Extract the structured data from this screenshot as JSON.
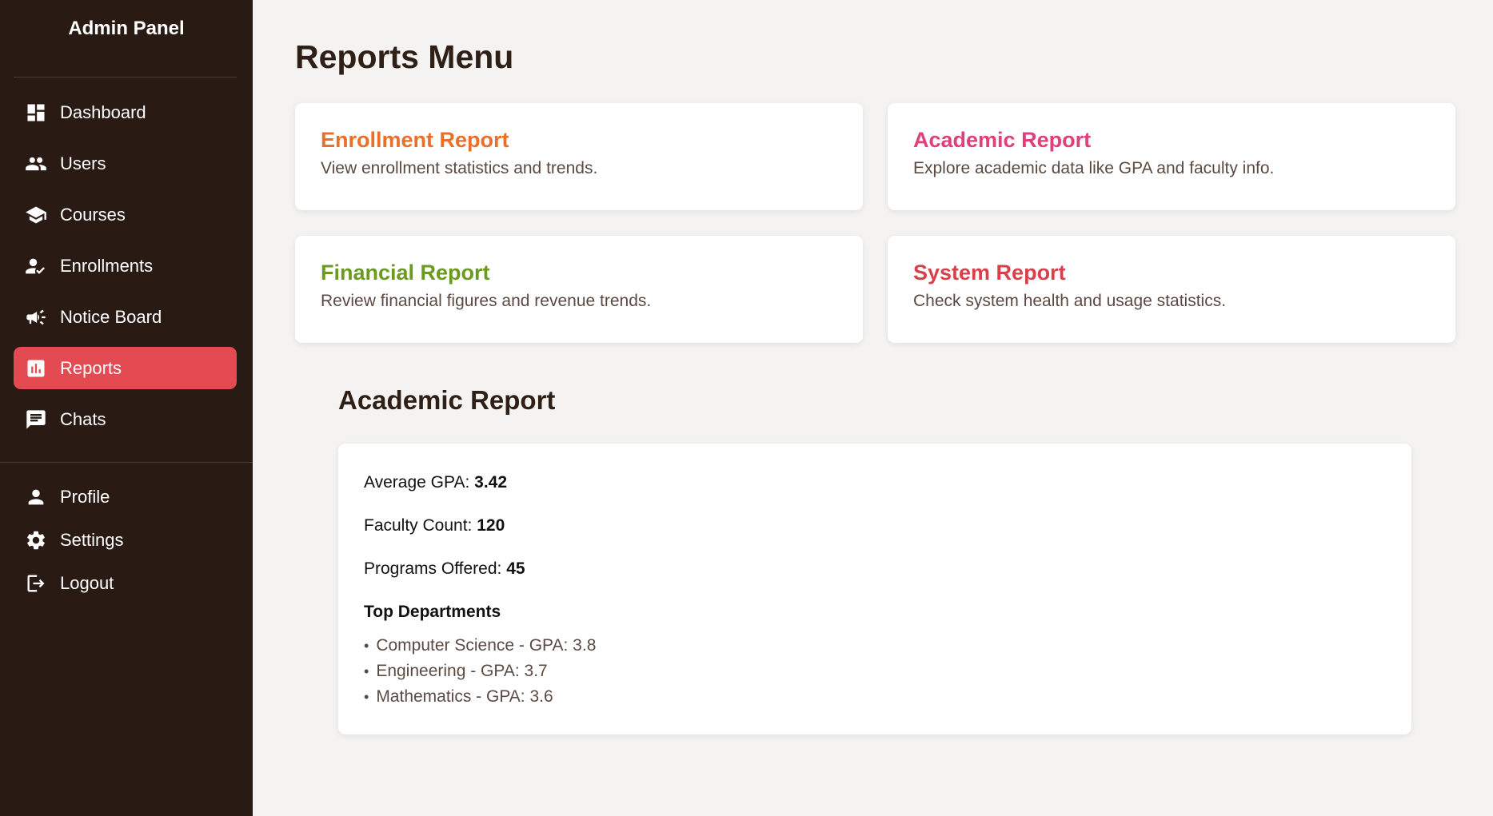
{
  "sidebar": {
    "title": "Admin Panel",
    "items": [
      {
        "label": "Dashboard",
        "icon": "dashboard-icon",
        "active": false
      },
      {
        "label": "Users",
        "icon": "users-icon",
        "active": false
      },
      {
        "label": "Courses",
        "icon": "graduation-cap-icon",
        "active": false
      },
      {
        "label": "Enrollments",
        "icon": "person-check-icon",
        "active": false
      },
      {
        "label": "Notice Board",
        "icon": "megaphone-icon",
        "active": false
      },
      {
        "label": "Reports",
        "icon": "bar-chart-icon",
        "active": true
      },
      {
        "label": "Chats",
        "icon": "chat-icon",
        "active": false
      }
    ],
    "bottom_items": [
      {
        "label": "Profile",
        "icon": "person-icon"
      },
      {
        "label": "Settings",
        "icon": "gear-icon"
      },
      {
        "label": "Logout",
        "icon": "logout-icon"
      }
    ],
    "active_color": "#e34a52",
    "background": "#2a1a14"
  },
  "main": {
    "title": "Reports Menu",
    "cards": [
      {
        "title": "Enrollment Report",
        "description": "View enrollment statistics and trends.",
        "color": "#e8702a"
      },
      {
        "title": "Academic Report",
        "description": "Explore academic data like GPA and faculty info.",
        "color": "#e0407a"
      },
      {
        "title": "Financial Report",
        "description": "Review financial figures and revenue trends.",
        "color": "#6a9a1f"
      },
      {
        "title": "System Report",
        "description": "Check system health and usage statistics.",
        "color": "#d8404a"
      }
    ],
    "report": {
      "title": "Academic Report",
      "stats": [
        {
          "label": "Average GPA:",
          "value": "3.42"
        },
        {
          "label": "Faculty Count:",
          "value": "120"
        },
        {
          "label": "Programs Offered:",
          "value": "45"
        }
      ],
      "departments_heading": "Top Departments",
      "departments": [
        "Computer Science - GPA: 3.8",
        "Engineering - GPA: 3.7",
        "Mathematics - GPA: 3.6"
      ]
    }
  }
}
